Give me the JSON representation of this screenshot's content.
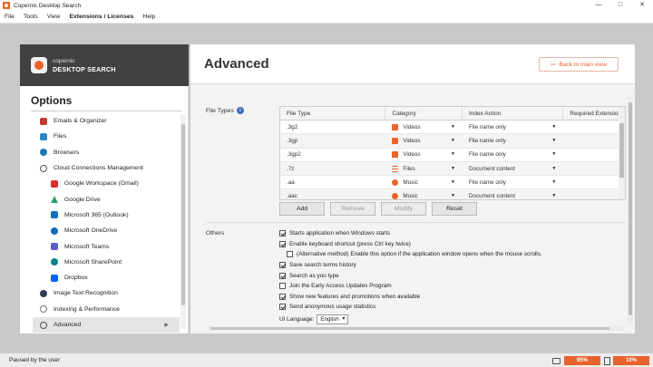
{
  "window": {
    "title": "Copernic Desktop Search",
    "minimize": "—",
    "maximize": "□",
    "close": "✕"
  },
  "menu": [
    "File",
    "Tools",
    "View",
    "Extensions / Licenses",
    "Help"
  ],
  "logo": {
    "line1": "copernic",
    "line2": "DESKTOP SEARCH"
  },
  "sidebar": {
    "title": "Options",
    "items": [
      {
        "label": "Emails & Organizer",
        "icon": "email-icon",
        "color": "#c0392b"
      },
      {
        "label": "Files",
        "icon": "file-icon",
        "color": "#2e86c1"
      },
      {
        "label": "Browsers",
        "icon": "globe-icon",
        "color": "#1f77b4"
      },
      {
        "label": "Cloud Connections Management",
        "icon": "cloud-icon",
        "color": "#555555"
      },
      {
        "label": "Google Workspace (Gmail)",
        "icon": "gmail-icon",
        "color": "#d93025"
      },
      {
        "label": "Google Drive",
        "icon": "google-drive-icon",
        "color": "#1fa463"
      },
      {
        "label": "Microsoft 365 (Outlook)",
        "icon": "outlook-icon",
        "color": "#0f6cbd"
      },
      {
        "label": "Microsoft OneDrive",
        "icon": "onedrive-icon",
        "color": "#0f6cbd"
      },
      {
        "label": "Microsoft Teams",
        "icon": "teams-icon",
        "color": "#5b5fc7"
      },
      {
        "label": "Microsoft SharePoint",
        "icon": "sharepoint-icon",
        "color": "#038387"
      },
      {
        "label": "Dropbox",
        "icon": "dropbox-icon",
        "color": "#0061fe"
      },
      {
        "label": "Image Text Recognition",
        "icon": "ocr-icon",
        "color": "#2c3e50"
      },
      {
        "label": "Indexing & Performance",
        "icon": "gauge-icon",
        "color": "#777777"
      },
      {
        "label": "Advanced",
        "icon": "search-icon",
        "color": "#555555"
      }
    ]
  },
  "header": {
    "title": "Advanced",
    "back_label": "Back to main view",
    "back_arrow": "⇦"
  },
  "file_types": {
    "label": "File Types",
    "info": "i",
    "columns": [
      "File Type",
      "Category",
      "Index Action",
      "Required Extension"
    ],
    "rows": [
      {
        "type": ".3g2",
        "category": "Videos",
        "cat_color": "#e8632b",
        "action": "File name only"
      },
      {
        "type": ".3gp",
        "category": "Videos",
        "cat_color": "#e8632b",
        "action": "File name only"
      },
      {
        "type": ".3gp2",
        "category": "Videos",
        "cat_color": "#e8632b",
        "action": "File name only"
      },
      {
        "type": ".7z",
        "category": "Files",
        "cat_color": "#e8632b",
        "action": "Document content"
      },
      {
        "type": ".aa",
        "category": "Music",
        "cat_color": "#e8632b",
        "action": "File name only"
      },
      {
        "type": ".aac",
        "category": "Music",
        "cat_color": "#e8632b",
        "action": "Document content"
      }
    ],
    "buttons": {
      "add": "Add",
      "remove": "Remove",
      "modify": "Modify",
      "reset": "Reset"
    }
  },
  "others": {
    "label": "Others",
    "options": [
      {
        "label": "Starts application when Windows starts",
        "checked": true
      },
      {
        "label": "Enable keyboard shortcut (press Ctrl key twice)",
        "checked": true
      },
      {
        "label": "(Alternative method) Enable this option if the application window opens when the mouse scrolls.",
        "checked": false
      },
      {
        "label": "Save search terms history",
        "checked": true
      },
      {
        "label": "Search as you type",
        "checked": true
      },
      {
        "label": "Join the Early Access Updates Program",
        "checked": false
      },
      {
        "label": "Show new features and promotions when available",
        "checked": true
      },
      {
        "label": "Send anonymous usage statistics",
        "checked": true
      }
    ],
    "language_label": "UI Language:",
    "language_value": "English"
  },
  "status": {
    "text": "Paused by the user",
    "pct1": "95%",
    "pct2": "10%"
  }
}
